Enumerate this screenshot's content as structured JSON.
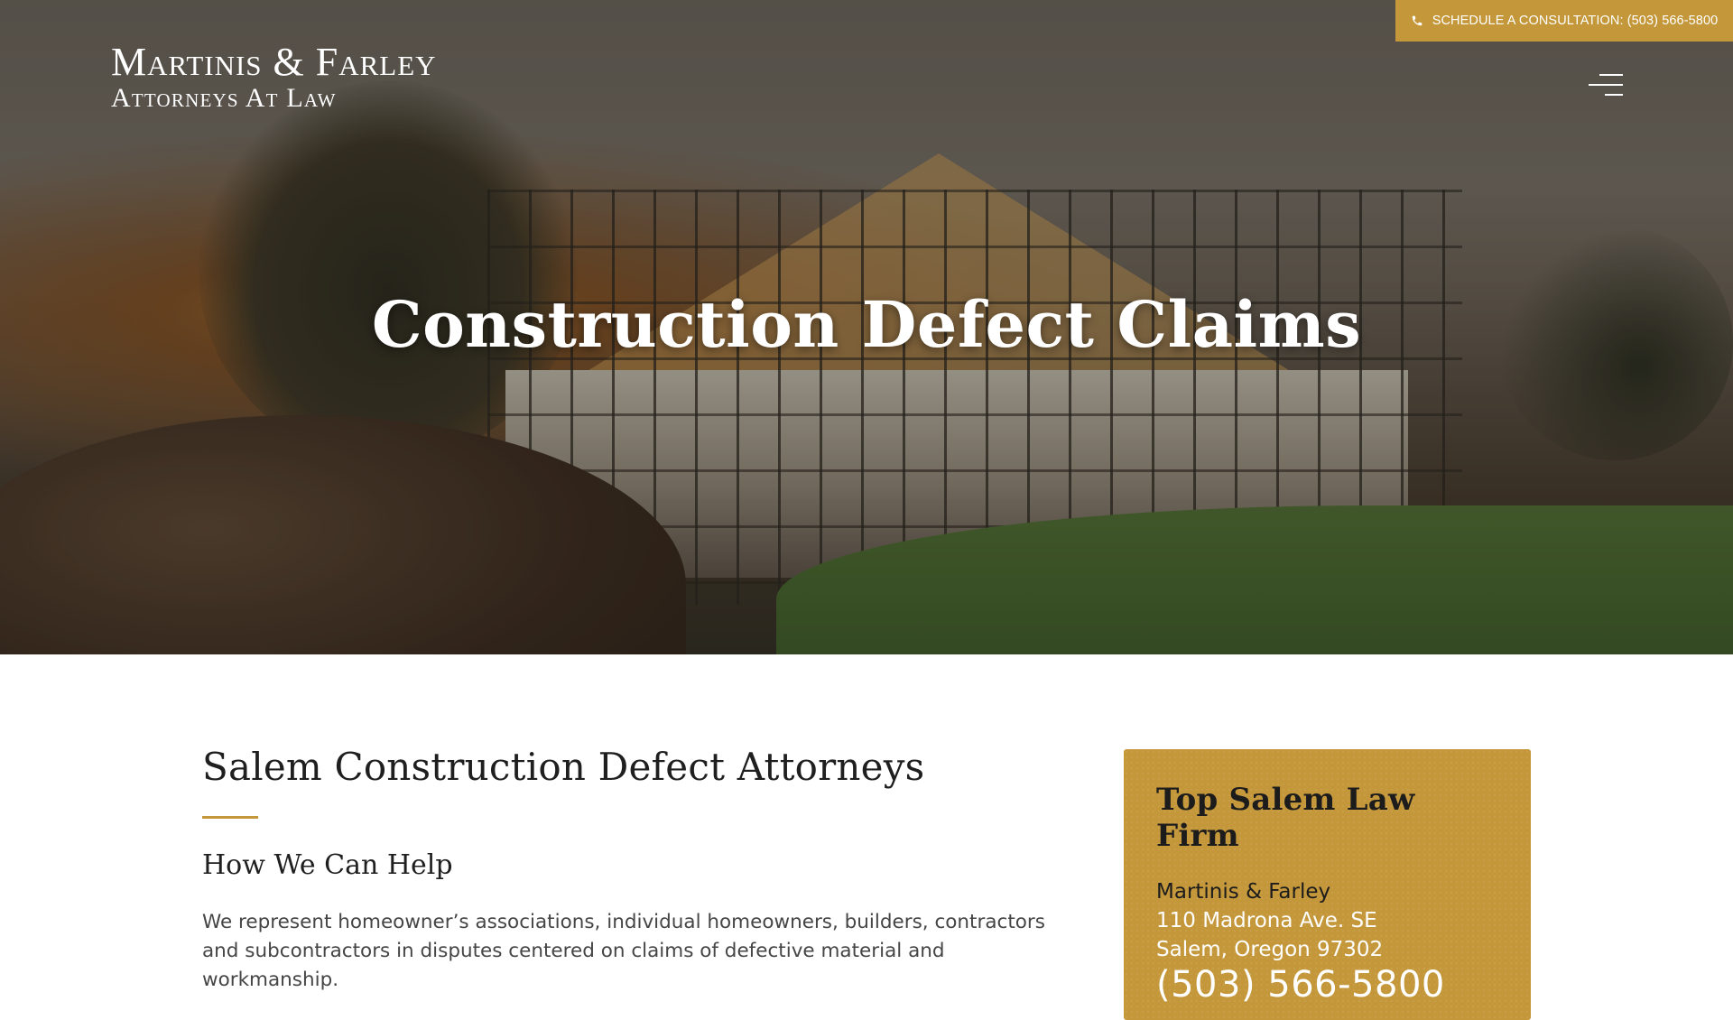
{
  "header": {
    "consult_text": "SCHEDULE A CONSULTATION: (503) 566-5800",
    "phone_icon": "phone-icon",
    "logo_line1": "Martinis & Farley",
    "logo_line2": "Attorneys At Law",
    "menu_icon": "hamburger-menu-icon"
  },
  "hero": {
    "title": "Construction Defect Claims"
  },
  "main": {
    "heading": "Salem Construction Defect Attorneys",
    "subheading": "How We Can Help",
    "intro": "We represent homeowner’s associations, individual homeowners,  builders, contractors and subcontractors in disputes centered on claims of defective material and workmanship."
  },
  "sidebar": {
    "title": "Top Salem Law Firm",
    "firm_name": "Martinis & Farley",
    "street": "110 Madrona Ave. SE",
    "city": "Salem, Oregon 97302",
    "phone": "(503) 566-5800"
  },
  "colors": {
    "accent_gold": "#c4973a",
    "heading_text": "#1f1f1f",
    "body_text": "#454545"
  }
}
